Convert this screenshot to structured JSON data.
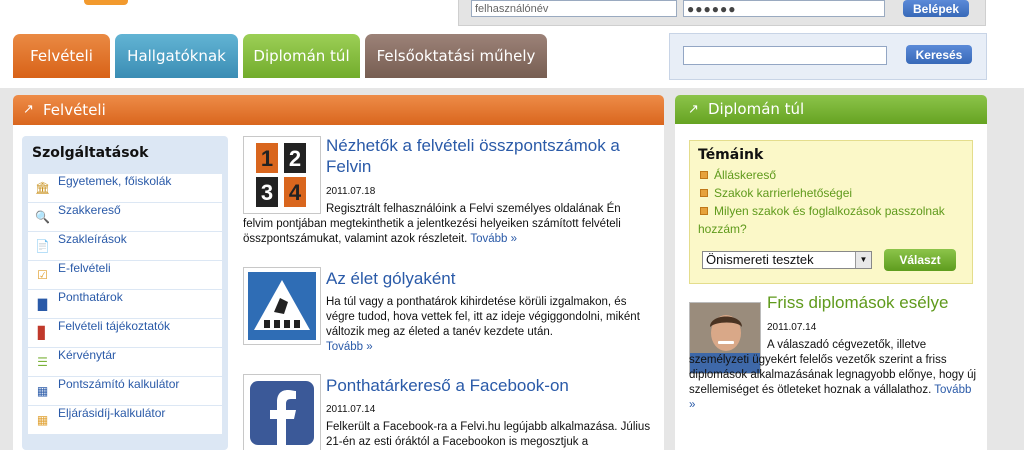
{
  "login": {
    "username_value": "felhasználónév",
    "password_value": "●●●●●●",
    "login_label": "Belépek"
  },
  "tabs": [
    {
      "label": "Felvételi",
      "color": "#d86218"
    },
    {
      "label": "Hallgatóknak",
      "color": "#3b8db4"
    },
    {
      "label": "Diplomán túl",
      "color": "#72ac2c"
    },
    {
      "label": "Felsőoktatási műhely",
      "color": "#775e52"
    }
  ],
  "search": {
    "value": "",
    "button_label": "Keresés"
  },
  "felveteli": {
    "header": "Felvételi",
    "services": {
      "title": "Szolgáltatások",
      "items": [
        {
          "label": "Egyetemek, főiskolák",
          "icon": "building-icon"
        },
        {
          "label": "Szakkereső",
          "icon": "magnifier-icon"
        },
        {
          "label": "Szakleírások",
          "icon": "document-search-icon"
        },
        {
          "label": "E-felvételi",
          "icon": "checklist-icon"
        },
        {
          "label": "Ponthatárok",
          "icon": "bar-chart-icon"
        },
        {
          "label": "Felvételi tájékoztatók",
          "icon": "book-icon"
        },
        {
          "label": "Kérvénytár",
          "icon": "document-icon"
        },
        {
          "label": "Pontszámító kalkulátor",
          "icon": "calculator-icon"
        },
        {
          "label": "Eljárásidíj-kalkulátor",
          "icon": "calculator-orange-icon"
        }
      ]
    },
    "news": [
      {
        "title": "Nézhetők a felvételi összpontszámok a Felvin",
        "date": "2011.07.18",
        "text": "Regisztrált felhasználóink a Felvi személyes oldalának Én felvim pontjában megtekinthetik a jelentkezési helyeiken számított felvételi összpontszámukat, valamint azok részleteit.",
        "more": "Tovább »",
        "thumb_digits": [
          "1",
          "2",
          "3",
          "4"
        ]
      },
      {
        "title": "Az élet gólyaként",
        "date": "",
        "text": "Ha túl vagy a ponthatárok kihirdetése körüli izgalmakon, és végre tudod, hova vettek fel, itt az ideje végiggondolni, miként változik meg az életed a tanév kezdete után.",
        "more": "Tovább »"
      },
      {
        "title": "Ponthatárkereső a Facebook-on",
        "date": "2011.07.14",
        "text": "Felkerült a Facebook-ra a Felvi.hu legújabb alkalmazása. Július 21-én az esti óráktól a Facebookon is megosztjuk a",
        "more": ""
      }
    ]
  },
  "diploman": {
    "header": "Diplomán túl",
    "topics_title": "Témáink",
    "topics": [
      "Álláskereső",
      "Szakok karrierlehetőségei",
      "Milyen szakok és foglalkozások passzolnak hozzám?"
    ],
    "select_value": "Önismereti tesztek",
    "choose_label": "Választ",
    "feature": {
      "title": "Friss diplomások esélye",
      "date": "2011.07.14",
      "text": "A válaszadó cégvezetők, illetve személyzeti ügyekért felelős vezetők szerint a friss diplomások alkalmazásának legnagyobb előnye, hogy új szellemiséget és ötleteket hoznak a vállalathoz.",
      "more": "Tovább »"
    }
  },
  "colors": {
    "link_blue": "#2a5aa8",
    "green": "#5f9a1c",
    "orange": "#d9661e"
  }
}
